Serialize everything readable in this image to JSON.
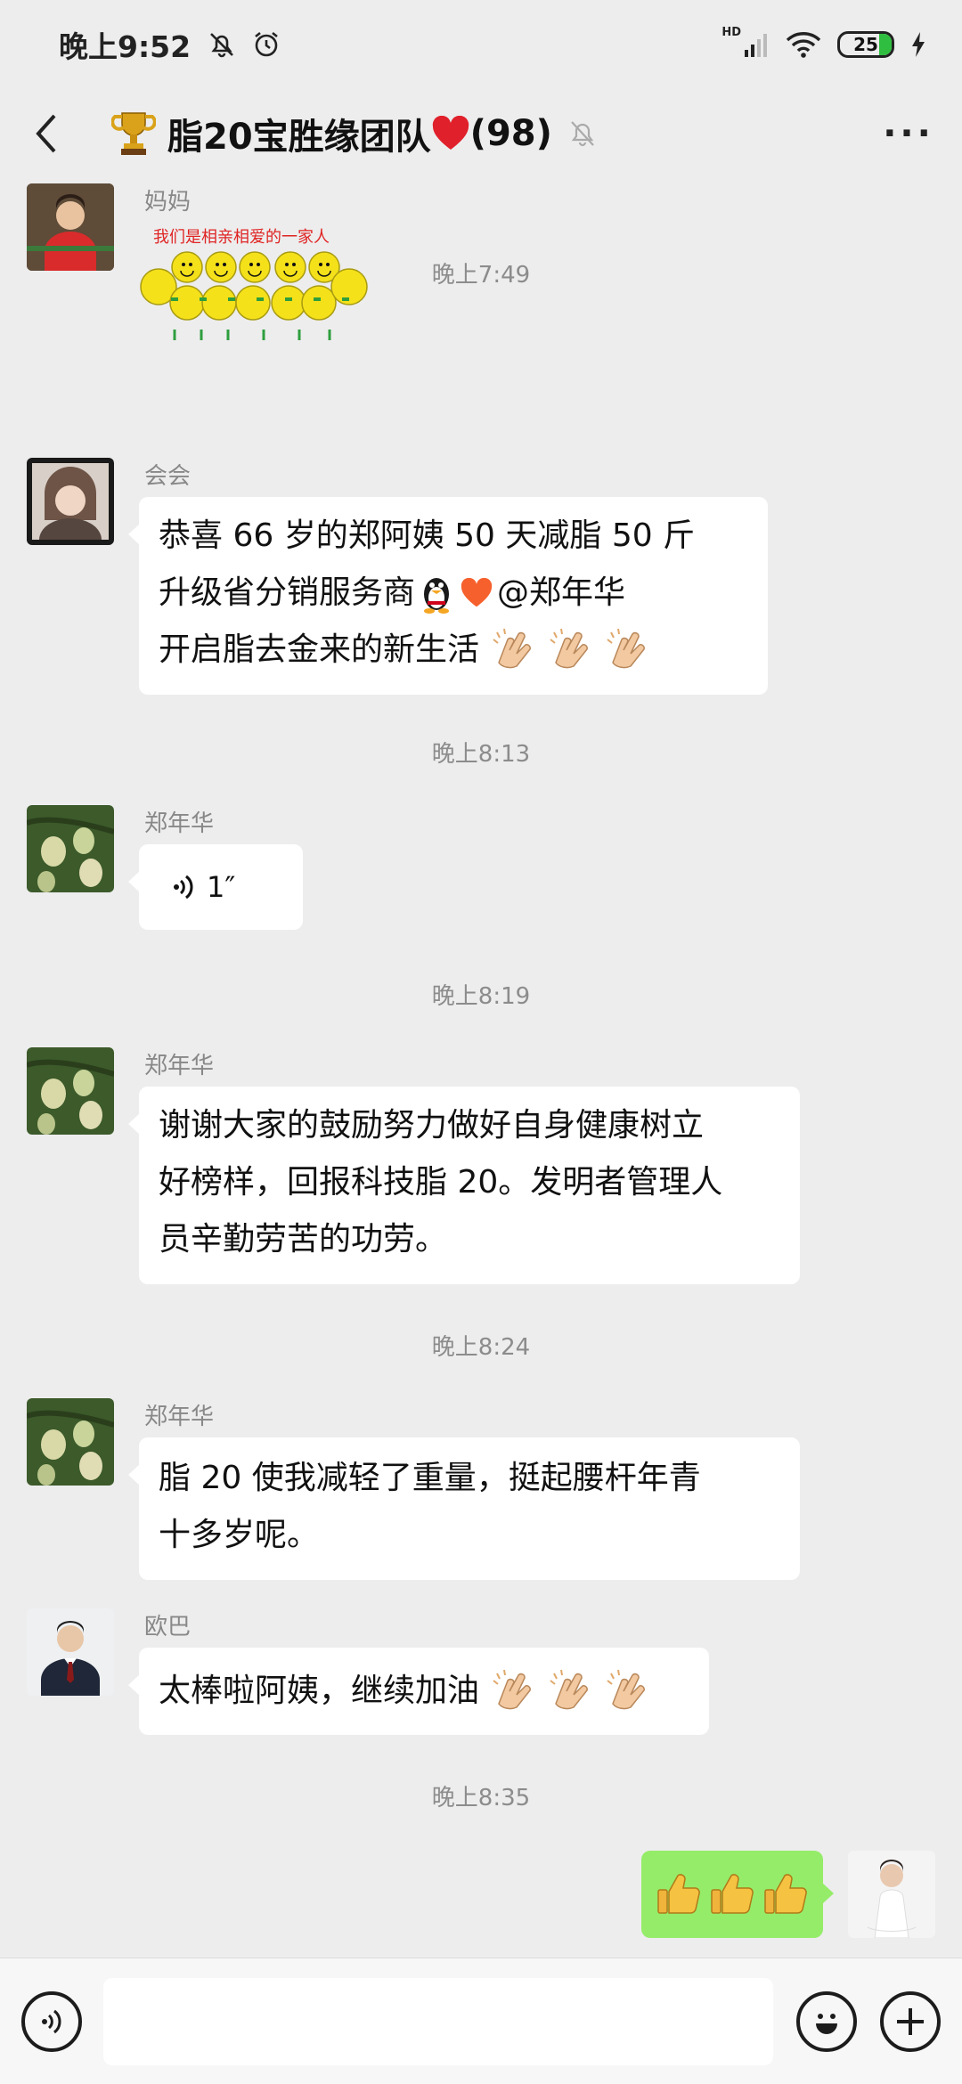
{
  "status_bar": {
    "time": "晚上9:52",
    "network": "HD",
    "battery": "25"
  },
  "header": {
    "title": "脂20宝胜缘团队",
    "member_count": "(98)",
    "more": "···"
  },
  "messages": [
    {
      "sender": "妈妈",
      "type": "sticker",
      "sticker_caption": "我们是相亲相爱的一家人"
    },
    {
      "timestamp": "晚上7:49"
    },
    {
      "sender": "会会",
      "type": "text",
      "lines": [
        "恭喜 66 岁的郑阿姨 50 天减脂 50 斤",
        "升级省分销服务商",
        "@郑年华",
        "开启脂去金来的新生活"
      ]
    },
    {
      "timestamp": "晚上8:13"
    },
    {
      "sender": "郑年华",
      "type": "voice",
      "duration": "1″"
    },
    {
      "timestamp": "晚上8:19"
    },
    {
      "sender": "郑年华",
      "type": "text",
      "lines": [
        "谢谢大家的鼓励努力做好自身健康树立",
        "好榜样，回报科技脂 20。发明者管理人",
        "员辛勤劳苦的功劳。"
      ]
    },
    {
      "timestamp": "晚上8:24"
    },
    {
      "sender": "郑年华",
      "type": "text",
      "lines": [
        "脂 20 使我减轻了重量，挺起腰杆年青",
        "十多岁呢。"
      ]
    },
    {
      "sender": "欧巴",
      "type": "text",
      "lines": [
        "太棒啦阿姨，继续加油"
      ]
    },
    {
      "timestamp": "晚上8:35"
    },
    {
      "sender": "me",
      "type": "emoji",
      "emoji": "thumbs-up x3"
    }
  ],
  "colors": {
    "background": "#ededed",
    "my_bubble": "#95ec69",
    "other_bubble": "#ffffff",
    "timestamp": "#8c8c8c"
  }
}
